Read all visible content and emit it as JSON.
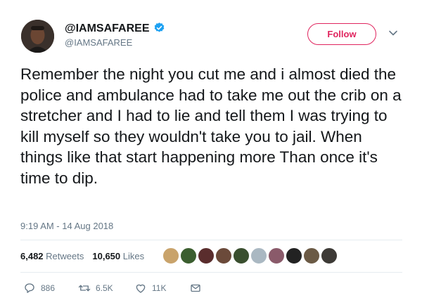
{
  "user": {
    "display_name": "@IAMSAFAREE",
    "handle": "@IAMSAFAREE",
    "verified": true
  },
  "follow_button": {
    "label": "Follow"
  },
  "tweet": {
    "text": "Remember the night you cut me and i almost died the police and ambulance had to take me out the crib on a stretcher and I had to lie and tell them I was trying to kill myself so they wouldn't take you to jail. When things like that start happening more Than once it's time to dip.",
    "timestamp": "9:19 AM - 14 Aug 2018"
  },
  "stats": {
    "retweets_count": "6,482",
    "retweets_label": "Retweets",
    "likes_count": "10,650",
    "likes_label": "Likes"
  },
  "likers": [
    {
      "color": "#c9a36b"
    },
    {
      "color": "#3b5e2f"
    },
    {
      "color": "#5a2d2d"
    },
    {
      "color": "#6b4a3a"
    },
    {
      "color": "#3a4f2f"
    },
    {
      "color": "#aab8c2"
    },
    {
      "color": "#8a5a6a"
    },
    {
      "color": "#222222"
    },
    {
      "color": "#6b5a45"
    },
    {
      "color": "#3d3a36"
    }
  ],
  "actions": {
    "replies": "886",
    "retweets": "6.5K",
    "likes": "11K"
  },
  "colors": {
    "accent": "#e0245e",
    "verified": "#1da1f2",
    "secondary_text": "#657786"
  }
}
